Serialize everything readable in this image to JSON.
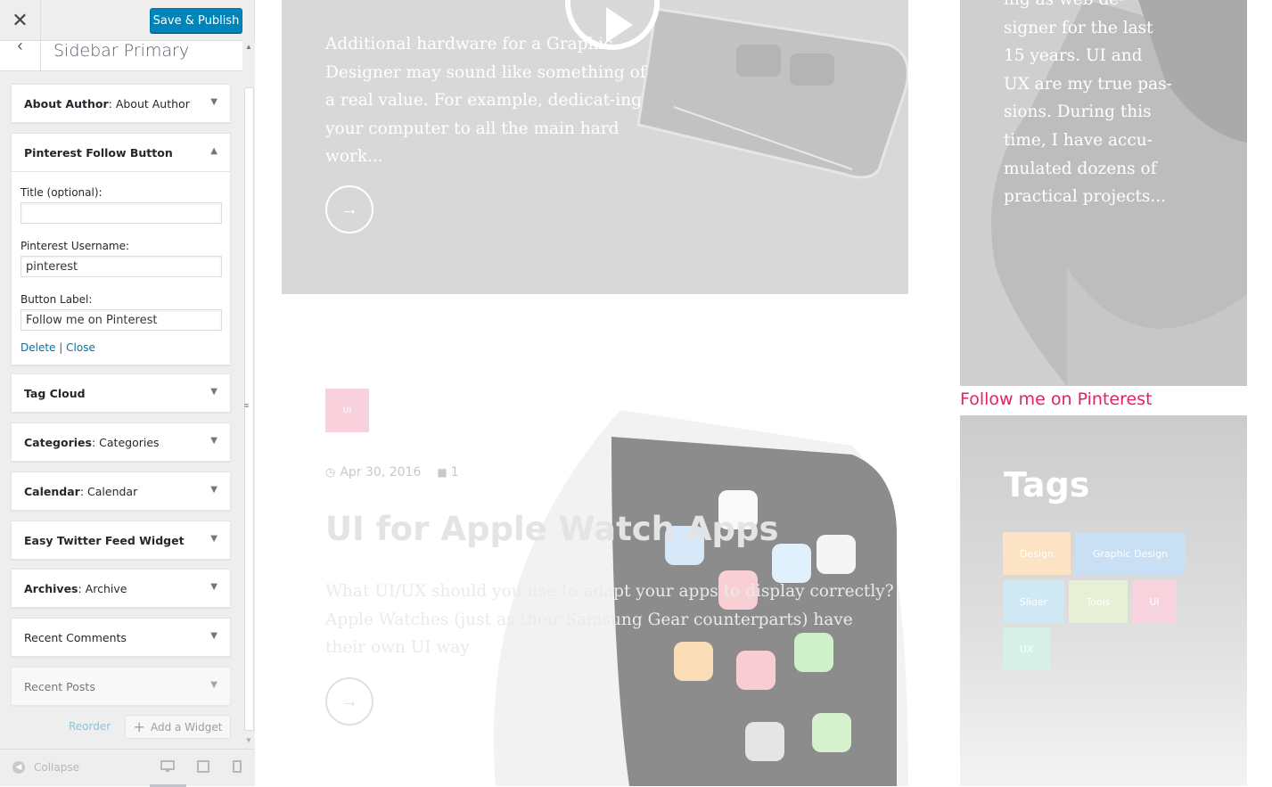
{
  "customizer": {
    "close_icon": "close-icon",
    "publish_label": "Save & Publish",
    "section_title": "Sidebar Primary",
    "widgets": [
      {
        "title": "About Author",
        "subtitle": ": About Author",
        "expanded": false
      },
      {
        "title": "Pinterest Follow Button",
        "subtitle": "",
        "expanded": true
      },
      {
        "title": "Tag Cloud",
        "subtitle": "",
        "expanded": false
      },
      {
        "title": "Categories",
        "subtitle": ": Categories",
        "expanded": false
      },
      {
        "title": "Calendar",
        "subtitle": ": Calendar",
        "expanded": false
      },
      {
        "title": "Easy Twitter Feed Widget",
        "subtitle": "",
        "expanded": false
      },
      {
        "title": "Archives",
        "subtitle": ": Archive",
        "expanded": false
      },
      {
        "title": "Recent Comments",
        "subtitle": "",
        "expanded": false
      },
      {
        "title": "Recent Posts",
        "subtitle": "",
        "expanded": false
      }
    ],
    "pinterest_form": {
      "title_label": "Title (optional):",
      "title_value": "",
      "username_label": "Pinterest Username:",
      "username_value": "pinterest",
      "button_label_label": "Button Label:",
      "button_label_value": "Follow me on Pinterest",
      "delete_label": "Delete",
      "separator": "|",
      "close_label": "Close"
    },
    "reorder_label": "Reorder",
    "add_widget_label": "Add a Widget",
    "collapse_label": "Collapse"
  },
  "preview": {
    "post1": {
      "excerpt": "Additional hardware for a Graphic Designer may sound like something of a real value. For example, dedicat-ing your computer to all the main hard work..."
    },
    "post2": {
      "category": "UI",
      "date": "Apr 30, 2016",
      "comments": "1",
      "title": "UI for Apple Watch Apps",
      "excerpt": "What UI/UX should you use to adapt your apps to display correctly? Apple Watches (just as their Samsung Gear counterparts) have their own UI way"
    },
    "author": {
      "text": "ing as web de-signer for the last 15 years. UI and UX are my true pas-sions. During this time, I have accu-mulated dozens of practical projects..."
    },
    "pinterest_button": "Follow me on Pinterest",
    "tags_title": "Tags",
    "tags": [
      {
        "label": "Design",
        "color": "#fbe3c3"
      },
      {
        "label": "Graphic Design",
        "color": "#c9dff4"
      },
      {
        "label": "Slider",
        "color": "#cfe8f3"
      },
      {
        "label": "Tools",
        "color": "#e7f0d6"
      },
      {
        "label": "UI",
        "color": "#f7d3de"
      },
      {
        "label": "UX",
        "color": "#d6f0e8"
      }
    ]
  }
}
